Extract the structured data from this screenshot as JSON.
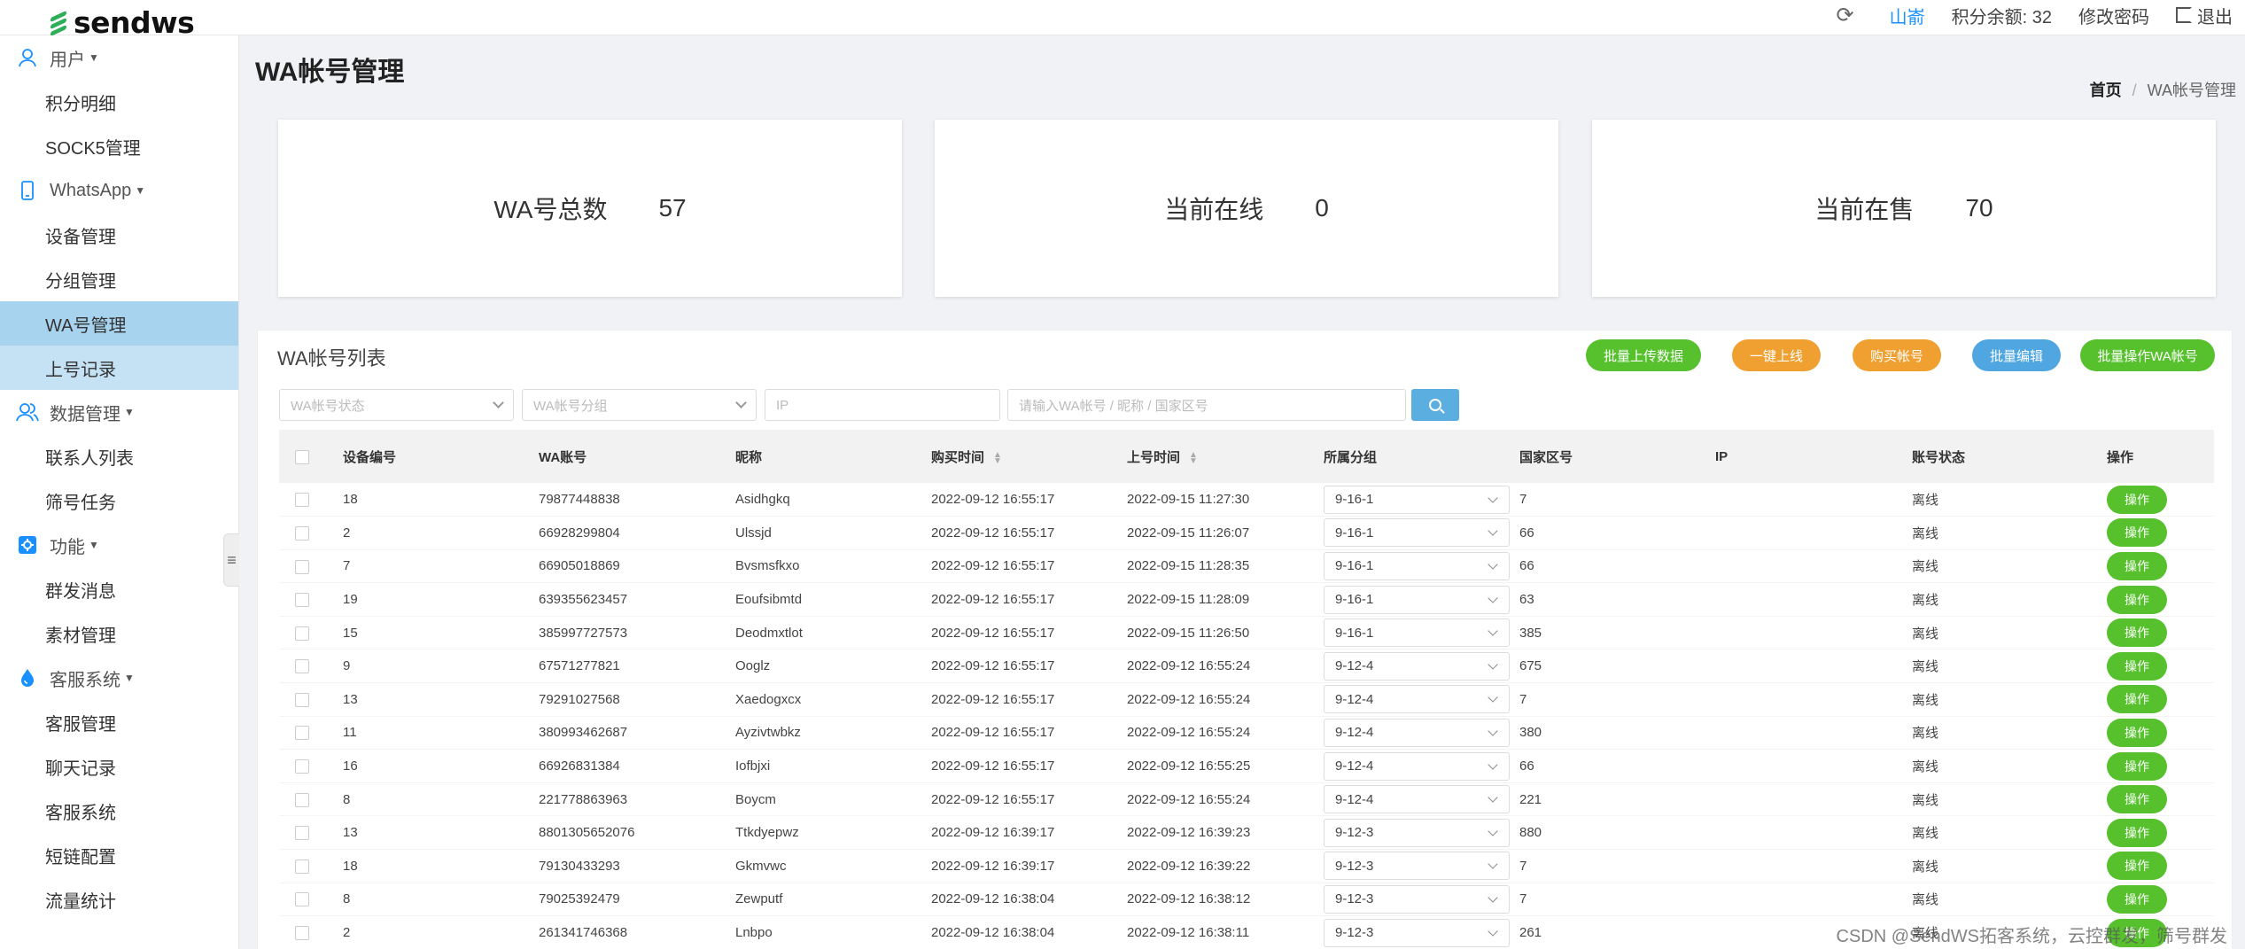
{
  "header": {
    "logo": "sendws",
    "user": "山嵛",
    "points": "积分余额: 32",
    "change_pwd": "修改密码",
    "logout": "退出"
  },
  "sidebar": {
    "groups": [
      {
        "label": "用户",
        "items": [
          "积分明细",
          "SOCK5管理"
        ]
      },
      {
        "label": "WhatsApp",
        "items": [
          "设备管理",
          "分组管理",
          "WA号管理",
          "上号记录"
        ]
      },
      {
        "label": "数据管理",
        "items": [
          "联系人列表",
          "筛号任务"
        ]
      },
      {
        "label": "功能",
        "items": [
          "群发消息",
          "素材管理"
        ]
      },
      {
        "label": "客服系统",
        "items": [
          "客服管理",
          "聊天记录",
          "客服系统",
          "短链配置",
          "流量统计"
        ]
      }
    ]
  },
  "page": {
    "title": "WA帐号管理",
    "breadcrumb": [
      "首页",
      "WA帐号管理"
    ]
  },
  "stats": [
    {
      "label": "WA号总数",
      "value": "57"
    },
    {
      "label": "当前在线",
      "value": "0"
    },
    {
      "label": "当前在售",
      "value": "70"
    }
  ],
  "panel": {
    "title": "WA帐号列表",
    "buttons": [
      {
        "label": "批量上传数据",
        "color": "#56c12c"
      },
      {
        "label": "一键上线",
        "color": "#f0a030"
      },
      {
        "label": "购买帐号",
        "color": "#f0a030"
      },
      {
        "label": "批量编辑",
        "color": "#4fa6e0"
      },
      {
        "label": "批量操作WA帐号",
        "color": "#56c12c"
      }
    ],
    "filters": {
      "status": "WA帐号状态",
      "group": "WA帐号分组",
      "ip": "IP",
      "search": "请输入WA帐号 / 昵称 / 国家区号"
    }
  },
  "table": {
    "columns": [
      "设备编号",
      "WA账号",
      "昵称",
      "购买时间",
      "上号时间",
      "所属分组",
      "国家区号",
      "IP",
      "账号状态",
      "操作"
    ],
    "rows": [
      [
        "18",
        "79877448838",
        "Asidhgkq",
        "2022-09-12 16:55:17",
        "2022-09-15 11:27:30",
        "9-16-1",
        "7",
        "",
        "离线",
        "操作"
      ],
      [
        "2",
        "66928299804",
        "Ulssjd",
        "2022-09-12 16:55:17",
        "2022-09-15 11:26:07",
        "9-16-1",
        "66",
        "",
        "离线",
        "操作"
      ],
      [
        "7",
        "66905018869",
        "Bvsmsfkxo",
        "2022-09-12 16:55:17",
        "2022-09-15 11:28:35",
        "9-16-1",
        "66",
        "",
        "离线",
        "操作"
      ],
      [
        "19",
        "639355623457",
        "Eoufsibmtd",
        "2022-09-12 16:55:17",
        "2022-09-15 11:28:09",
        "9-16-1",
        "63",
        "",
        "离线",
        "操作"
      ],
      [
        "15",
        "385997727573",
        "Deodmxtlot",
        "2022-09-12 16:55:17",
        "2022-09-15 11:26:50",
        "9-16-1",
        "385",
        "",
        "离线",
        "操作"
      ],
      [
        "9",
        "67571277821",
        "Ooglz",
        "2022-09-12 16:55:17",
        "2022-09-12 16:55:24",
        "9-12-4",
        "675",
        "",
        "离线",
        "操作"
      ],
      [
        "13",
        "79291027568",
        "Xaedogxcx",
        "2022-09-12 16:55:17",
        "2022-09-12 16:55:24",
        "9-12-4",
        "7",
        "",
        "离线",
        "操作"
      ],
      [
        "11",
        "380993462687",
        "Ayzivtwbkz",
        "2022-09-12 16:55:17",
        "2022-09-12 16:55:24",
        "9-12-4",
        "380",
        "",
        "离线",
        "操作"
      ],
      [
        "16",
        "66926831384",
        "Iofbjxi",
        "2022-09-12 16:55:17",
        "2022-09-12 16:55:25",
        "9-12-4",
        "66",
        "",
        "离线",
        "操作"
      ],
      [
        "8",
        "221778863963",
        "Boycm",
        "2022-09-12 16:55:17",
        "2022-09-12 16:55:24",
        "9-12-4",
        "221",
        "",
        "离线",
        "操作"
      ],
      [
        "13",
        "8801305652076",
        "Ttkdyepwz",
        "2022-09-12 16:39:17",
        "2022-09-12 16:39:23",
        "9-12-3",
        "880",
        "",
        "离线",
        "操作"
      ],
      [
        "18",
        "79130433293",
        "Gkmvwc",
        "2022-09-12 16:39:17",
        "2022-09-12 16:39:22",
        "9-12-3",
        "7",
        "",
        "离线",
        "操作"
      ],
      [
        "8",
        "79025392479",
        "Zewputf",
        "2022-09-12 16:38:04",
        "2022-09-12 16:38:12",
        "9-12-3",
        "7",
        "",
        "离线",
        "操作"
      ],
      [
        "2",
        "261341746368",
        "Lnbpo",
        "2022-09-12 16:38:04",
        "2022-09-12 16:38:11",
        "9-12-3",
        "261",
        "",
        "离线",
        "操作"
      ]
    ]
  },
  "watermark": "CSDN @SendWS拓客系统，云控群发，筛号群发"
}
